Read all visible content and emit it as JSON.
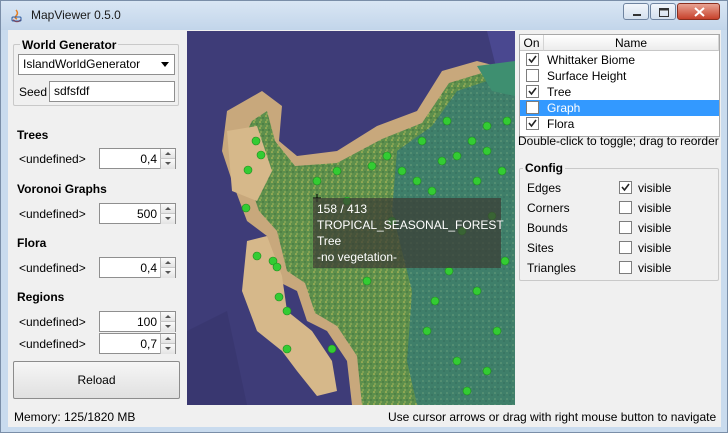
{
  "window": {
    "title": "MapViewer 0.5.0"
  },
  "world_generator": {
    "group_title": "World Generator",
    "generator_selected": "IslandWorldGenerator",
    "seed_label": "Seed",
    "seed_value": "sdfsfdf"
  },
  "sections": {
    "trees": {
      "title": "Trees",
      "label": "<undefined>",
      "value": "0,4"
    },
    "voronoi": {
      "title": "Voronoi Graphs",
      "label": "<undefined>",
      "value": "500"
    },
    "flora": {
      "title": "Flora",
      "label": "<undefined>",
      "value": "0,4"
    },
    "regions": {
      "title": "Regions",
      "rows": [
        {
          "label": "<undefined>",
          "value": "100"
        },
        {
          "label": "<undefined>",
          "value": "0,7"
        }
      ]
    }
  },
  "reload_label": "Reload",
  "tooltip": {
    "coords": "158 / 413",
    "biome": "TROPICAL_SEASONAL_FOREST",
    "feature": "Tree",
    "vegetation": "-no vegetation-"
  },
  "layers": {
    "col_on": "On",
    "col_name": "Name",
    "items": [
      {
        "name": "Whittaker Biome",
        "on": true,
        "selected": false
      },
      {
        "name": "Surface Height",
        "on": false,
        "selected": false
      },
      {
        "name": "Tree",
        "on": true,
        "selected": false
      },
      {
        "name": "Graph",
        "on": false,
        "selected": true
      },
      {
        "name": "Flora",
        "on": true,
        "selected": false
      }
    ],
    "hint": "Double-click to toggle; drag to reorder"
  },
  "config": {
    "title": "Config",
    "items": [
      {
        "name": "Edges",
        "checked": true,
        "label": "visible"
      },
      {
        "name": "Corners",
        "checked": false,
        "label": "visible"
      },
      {
        "name": "Bounds",
        "checked": false,
        "label": "visible"
      },
      {
        "name": "Sites",
        "checked": false,
        "label": "visible"
      },
      {
        "name": "Triangles",
        "checked": false,
        "label": "visible"
      }
    ]
  },
  "status": {
    "memory": "Memory: 125/1820 MB",
    "help": "Use cursor arrows or drag with right mouse button to navigate"
  },
  "colors": {
    "ocean": "#3e3c78",
    "beach": "#c8a87c",
    "forest": "#5d8f4c",
    "rainforest": "#3f7f6a",
    "tree": "#33cc33",
    "selection": "#3399ff"
  }
}
